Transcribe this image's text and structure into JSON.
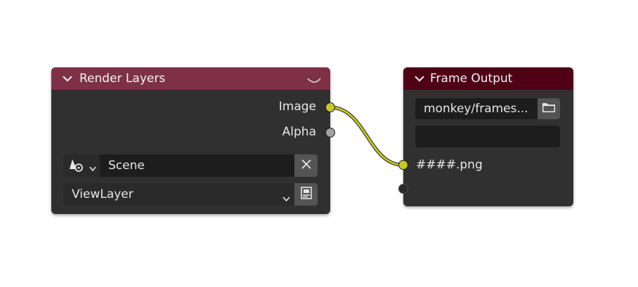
{
  "render_layers": {
    "title": "Render Layers",
    "outputs": [
      "Image",
      "Alpha"
    ],
    "scene": {
      "value": "Scene"
    },
    "view_layer": {
      "value": "ViewLayer"
    }
  },
  "frame_output": {
    "title": "Frame Output",
    "path": {
      "value": "monkey/frames..."
    },
    "secondary_field": {
      "value": ""
    },
    "input_label": "####.png"
  },
  "colors": {
    "render_header": "#7e3146",
    "output_header": "#4f0017",
    "node_body": "#303030",
    "link": "#c7c729"
  },
  "icons": [
    "chevron-down-icon",
    "collapse-caret-icon",
    "scene-data-icon",
    "close-icon",
    "chevron-down-small-icon",
    "render-result-icon",
    "folder-icon"
  ]
}
